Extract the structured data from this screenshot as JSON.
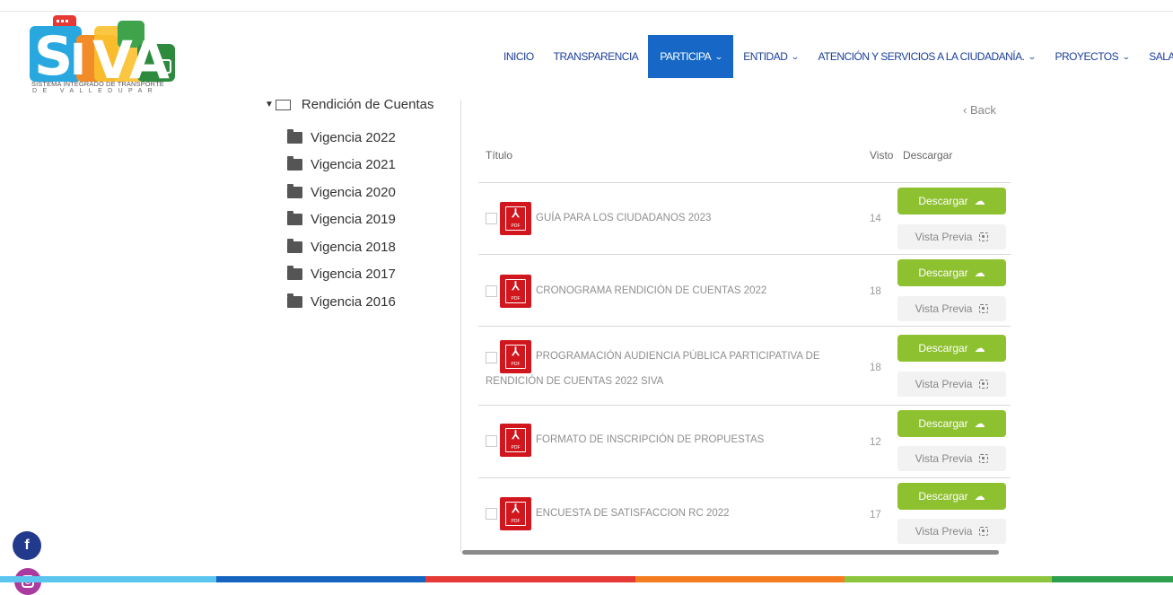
{
  "brand": {
    "logo_text": "SIVA",
    "subtitle_line1": "SISTEMA INTEGRADO DE TRANSPORTE",
    "subtitle_line2": "DE VALLEDUPAR"
  },
  "nav": {
    "items": [
      {
        "label": "INICIO",
        "dropdown": false,
        "active": false
      },
      {
        "label": "TRANSPARENCIA",
        "dropdown": false,
        "active": false
      },
      {
        "label": "PARTICIPA",
        "dropdown": true,
        "active": true
      },
      {
        "label": "ENTIDAD",
        "dropdown": true,
        "active": false
      },
      {
        "label": "ATENCIÓN Y SERVICIOS A LA CIUDADANÍA.",
        "dropdown": true,
        "active": false
      },
      {
        "label": "PROYECTOS",
        "dropdown": true,
        "active": false
      },
      {
        "label": "SALA DE PRI",
        "dropdown": false,
        "active": false
      }
    ]
  },
  "sidebar": {
    "root_label": "Rendición de Cuentas",
    "items": [
      {
        "label": "Vigencia 2022"
      },
      {
        "label": "Vigencia 2021"
      },
      {
        "label": "Vigencia 2020"
      },
      {
        "label": "Vigencia 2019"
      },
      {
        "label": "Vigencia 2018"
      },
      {
        "label": "Vigencia 2017"
      },
      {
        "label": "Vigencia 2016"
      }
    ]
  },
  "main": {
    "back_label": "‹ Back",
    "columns": {
      "title": "Título",
      "views": "Visto",
      "download": "Descargar"
    },
    "download_label": "Descargar",
    "preview_label": "Vista Previa",
    "pdf_badge": "PDF",
    "documents": [
      {
        "title": "GUÍA PARA LOS CIUDADANOS 2023",
        "title_cont": "",
        "views": "14"
      },
      {
        "title": "CRONOGRAMA RENDICIÓN DE CUENTAS 2022",
        "title_cont": "",
        "views": "18"
      },
      {
        "title": "PROGRAMACIÓN AUDIENCIA PÚBLICA PARTICIPATIVA DE",
        "title_cont": "RENDICIÓN DE CUENTAS 2022 SIVA",
        "views": "18"
      },
      {
        "title": "FORMATO DE INSCRIPCIÓN DE PROPUESTAS",
        "title_cont": "",
        "views": "12"
      },
      {
        "title": "ENCUESTA DE SATISFACCION RC 2022",
        "title_cont": "",
        "views": "17"
      }
    ]
  },
  "social": {
    "facebook": "f"
  },
  "colors": {
    "accent_blue": "#1768c6",
    "download_green": "#8ec130",
    "pdf_red": "#d2161e",
    "bar": [
      "#5bc4ef",
      "#1565c0",
      "#e53935",
      "#f57c20",
      "#8cc63f",
      "#2e9e4f"
    ]
  }
}
